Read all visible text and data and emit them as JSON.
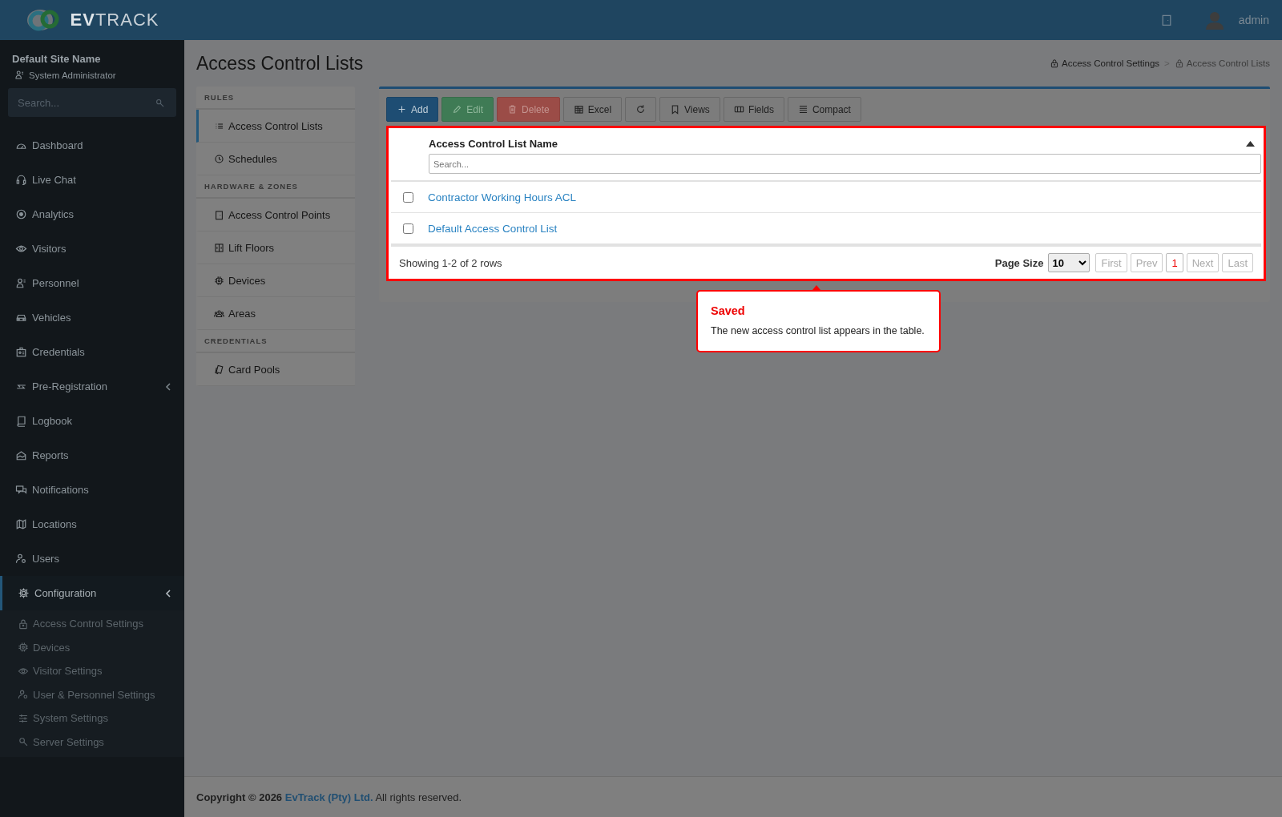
{
  "header": {
    "logo": "**EV**TRACK",
    "user": "admin"
  },
  "sidebar": {
    "site": "Default Site Name",
    "role": "System Administrator",
    "search": {
      "placeholder": "Search..."
    },
    "items": [
      {
        "label": "Dashboard",
        "selected": false
      },
      {
        "label": "Live Chat",
        "selected": false
      },
      {
        "label": "Analytics",
        "selected": false
      },
      {
        "label": "Visitors",
        "selected": false
      },
      {
        "label": "Personnel",
        "selected": false
      },
      {
        "label": "Vehicles",
        "selected": false
      },
      {
        "label": "Credentials",
        "selected": false
      },
      {
        "label": "Pre-Registration",
        "selected": false,
        "kind": "group",
        "expanded": false
      },
      {
        "label": "Logbook",
        "selected": false
      },
      {
        "label": "Reports",
        "selected": false
      },
      {
        "label": "Notifications",
        "selected": false
      },
      {
        "label": "Locations",
        "selected": false
      },
      {
        "label": "Users",
        "selected": false
      },
      {
        "label": "Configuration",
        "selected": true,
        "kind": "group",
        "expanded": true,
        "children": [
          {
            "label": "Access Control Settings",
            "selected": false
          },
          {
            "label": "Devices",
            "selected": false
          },
          {
            "label": "Visitor Settings",
            "selected": false
          },
          {
            "label": "User & Personnel Settings",
            "selected": false
          },
          {
            "label": "System Settings",
            "selected": false
          },
          {
            "label": "Server Settings",
            "selected": false
          }
        ]
      }
    ]
  },
  "page": {
    "title": "Access Control Lists",
    "breadcrumbs": [
      "Access Control Settings",
      "Access Control Lists"
    ],
    "breadcrumb_separator": ">"
  },
  "subnav": [
    {
      "title": "RULES",
      "items": [
        {
          "label": "Access Control Lists",
          "selected": true
        },
        {
          "label": "Schedules",
          "selected": false
        }
      ]
    },
    {
      "title": "HARDWARE & ZONES",
      "items": [
        {
          "label": "Access Control Points",
          "selected": false
        },
        {
          "label": "Lift Floors",
          "selected": false
        },
        {
          "label": "Devices",
          "selected": false
        },
        {
          "label": "Areas",
          "selected": false
        }
      ]
    },
    {
      "title": "CREDENTIALS",
      "items": [
        {
          "label": "Card Pools",
          "selected": false
        }
      ]
    }
  ],
  "toolbar": [
    {
      "label": "Add",
      "kind": "primary",
      "disabled": false
    },
    {
      "label": "Edit",
      "kind": "success",
      "disabled": true
    },
    {
      "label": "Delete",
      "kind": "danger",
      "disabled": true
    },
    {
      "label": "Excel",
      "kind": "default",
      "disabled": false
    },
    {
      "kind": "default",
      "disabled": false
    },
    {
      "label": "Views",
      "kind": "default",
      "disabled": false
    },
    {
      "label": "Fields",
      "kind": "default",
      "disabled": false
    },
    {
      "label": "Compact",
      "kind": "default",
      "disabled": false
    }
  ],
  "table": {
    "column": "Access Control List Name",
    "sort_ascending": true,
    "search": {
      "placeholder": "Search..."
    },
    "rows": [
      {
        "name": "Contractor Working Hours ACL",
        "checked": false
      },
      {
        "name": "Default Access Control List",
        "checked": false
      }
    ],
    "summary": "Showing 1-2 of 2 rows",
    "page_size_label": "Page Size",
    "page_size": "10",
    "pages": [
      {
        "label": "First",
        "kind": "nav",
        "disabled": true
      },
      {
        "label": "Prev",
        "kind": "nav",
        "disabled": true
      },
      {
        "label": "1",
        "kind": "page",
        "selected": true
      },
      {
        "label": "Next",
        "kind": "nav",
        "disabled": true
      },
      {
        "label": "Last",
        "kind": "nav",
        "disabled": true
      }
    ]
  },
  "callout": {
    "title": "Saved",
    "text": "The new access control list appears in the table."
  },
  "footer": {
    "prefix": "Copyright © 2026",
    "link": "EvTrack (Pty) Ltd.",
    "suffix": "All rights reserved."
  }
}
